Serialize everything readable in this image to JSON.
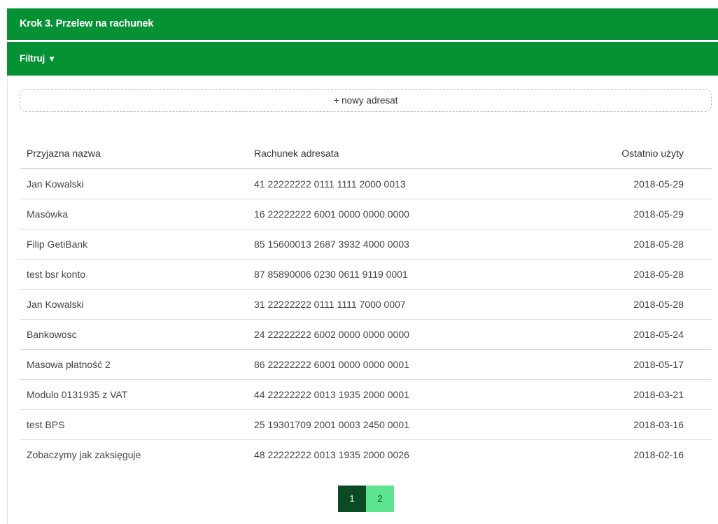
{
  "header": {
    "title": "Krok 3. Przelew na rachunek"
  },
  "filter": {
    "label": "Filtruj",
    "caret": "▼"
  },
  "new_recipient": {
    "label": "+ nowy adresat"
  },
  "table": {
    "columns": [
      "Przyjazna nazwa",
      "Rachunek adresata",
      "Ostatnio użyty"
    ],
    "rows": [
      {
        "name": "Jan Kowalski",
        "account": "41 22222222 0111 1111 2000 0013",
        "last_used": "2018-05-29"
      },
      {
        "name": "Masówka",
        "account": "16 22222222 6001 0000 0000 0000",
        "last_used": "2018-05-29"
      },
      {
        "name": "Filip GetiBank",
        "account": "85 15600013 2687 3932 4000 0003",
        "last_used": "2018-05-28"
      },
      {
        "name": "test bsr konto",
        "account": "87 85890006 0230 0611 9119 0001",
        "last_used": "2018-05-28"
      },
      {
        "name": "Jan Kowalski",
        "account": "31 22222222 0111 1111 7000 0007",
        "last_used": "2018-05-28"
      },
      {
        "name": "Bankowosc",
        "account": "24 22222222 6002 0000 0000 0000",
        "last_used": "2018-05-24"
      },
      {
        "name": "Masowa płatność 2",
        "account": "86 22222222 6001 0000 0000 0001",
        "last_used": "2018-05-17"
      },
      {
        "name": "Modulo 0131935 z VAT",
        "account": "44 22222222 0013 1935 2000 0001",
        "last_used": "2018-03-21"
      },
      {
        "name": "test BPS",
        "account": "25 19301709 2001 0003 2450 0001",
        "last_used": "2018-03-16"
      },
      {
        "name": "Zobaczymy jak zaksięguje",
        "account": "48 22222222 0013 1935 2000 0026",
        "last_used": "2018-02-16"
      }
    ]
  },
  "pagination": {
    "pages": [
      "1",
      "2"
    ],
    "current": "1"
  },
  "colors": {
    "header_green": "#069134",
    "page_active": "#0a4a24",
    "page_inactive": "#5ee38f"
  }
}
